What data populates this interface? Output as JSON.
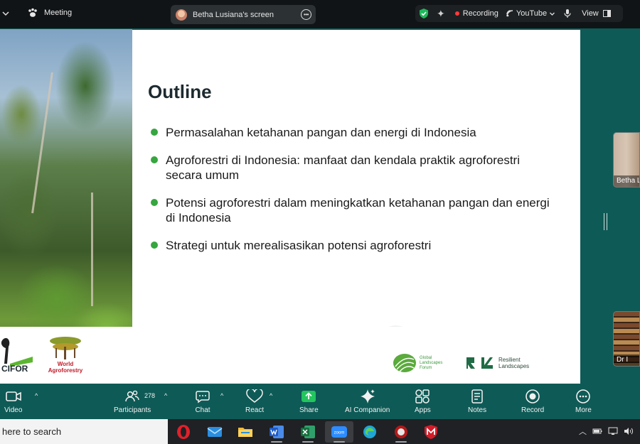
{
  "topbar": {
    "meeting_label": "Meeting",
    "screen_label": "Betha Lusiana's screen",
    "recording_label": "Recording",
    "youtube_label": "YouTube",
    "view_label": "View"
  },
  "slide": {
    "title": "Outline",
    "bullets": [
      "Permasalahan ketahanan pangan dan energi di Indonesia",
      "Agroforestri di Indonesia: manfaat dan kendala praktik agroforestri secara umum",
      "Potensi agroforestri dalam meningkatkan ketahanan pangan dan energi di Indonesia",
      "Strategi untuk merealisasikan potensi agroforestri"
    ],
    "footer": {
      "cifor": "CIFOR",
      "world_agroforestry_line1": "World",
      "world_agroforestry_line2": "Agroforestry",
      "glf_line1": "Global",
      "glf_line2": "Landscapes",
      "glf_line3": "Forum",
      "rl_line1": "Resilient",
      "rl_line2": "Landscapes"
    }
  },
  "participants_panel": {
    "thumb1_label": "Betha L",
    "thumb2_label": "Dr I"
  },
  "toolbar": {
    "video": "Video",
    "participants": "Participants",
    "participant_count": "278",
    "chat": "Chat",
    "react": "React",
    "share": "Share",
    "ai_companion": "AI Companion",
    "apps": "Apps",
    "notes": "Notes",
    "record": "Record",
    "more": "More"
  },
  "taskbar": {
    "search_text": "here to search",
    "apps": [
      "opera-browser",
      "mail",
      "file-explorer",
      "word",
      "excel",
      "zoom",
      "edge",
      "app-64",
      "mcafee"
    ],
    "zoom_label": "zoom"
  },
  "colors": {
    "stage_bg": "#0e5a56",
    "bullet_green": "#36a63f",
    "recording_red": "#ff3b3b",
    "share_green": "#22c55e"
  }
}
